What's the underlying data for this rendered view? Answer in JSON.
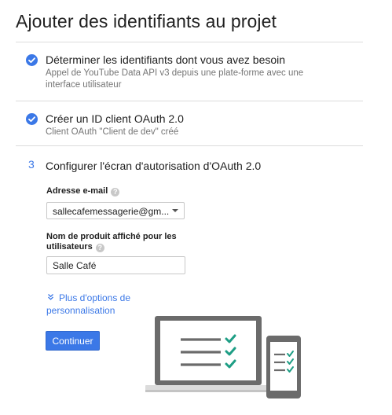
{
  "page": {
    "title": "Ajouter des identifiants au projet"
  },
  "steps": [
    {
      "status": "completed",
      "title": "Déterminer les identifiants dont vous avez besoin",
      "subtitle": "Appel de YouTube Data API v3 depuis une plate-forme avec une interface utilisateur"
    },
    {
      "status": "completed",
      "title": "Créer un ID client OAuth 2.0",
      "subtitle": "Client OAuth \"Client de dev\" créé"
    },
    {
      "status": "active",
      "number": "3",
      "title": "Configurer l'écran d'autorisation d'OAuth 2.0"
    }
  ],
  "form": {
    "email_label": "Adresse e-mail",
    "email_value": "sallecafemessagerie@gm...",
    "product_label": "Nom de produit affiché pour les utilisateurs",
    "product_value": "Salle Café",
    "more_options_label": "Plus d'options de personnalisation",
    "continue_label": "Continuer"
  },
  "colors": {
    "accent": "#3b78e7",
    "check_green": "#1e9e85",
    "device_gray": "#6b6b6b"
  },
  "icons": {
    "step_done": "check-circle-icon",
    "help": "help-circle-icon",
    "expand": "double-chevron-down-icon",
    "illustration": "laptop-phone-checklist-illustration"
  }
}
